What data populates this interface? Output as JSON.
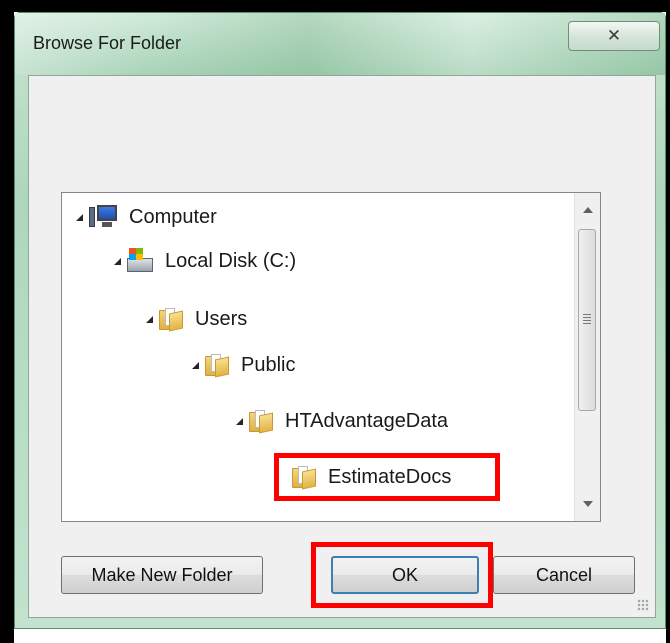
{
  "window": {
    "title": "Browse For Folder",
    "close_label": "✕"
  },
  "tree": {
    "items": [
      {
        "label": "Computer",
        "icon": "computer-icon",
        "expanded": true
      },
      {
        "label": "Local Disk (C:)",
        "icon": "disk-icon",
        "expanded": true
      },
      {
        "label": "Users",
        "icon": "folder-icon",
        "expanded": true
      },
      {
        "label": "Public",
        "icon": "folder-icon",
        "expanded": true
      },
      {
        "label": "HTAdvantageData",
        "icon": "folder-icon",
        "expanded": true
      },
      {
        "label": "EstimateDocs",
        "icon": "folder-icon",
        "selected": true
      }
    ]
  },
  "buttons": {
    "make_new_folder": "Make New Folder",
    "ok": "OK",
    "cancel": "Cancel"
  },
  "colors": {
    "highlight": "#ff0000",
    "title_bar": "#aed6bd"
  }
}
